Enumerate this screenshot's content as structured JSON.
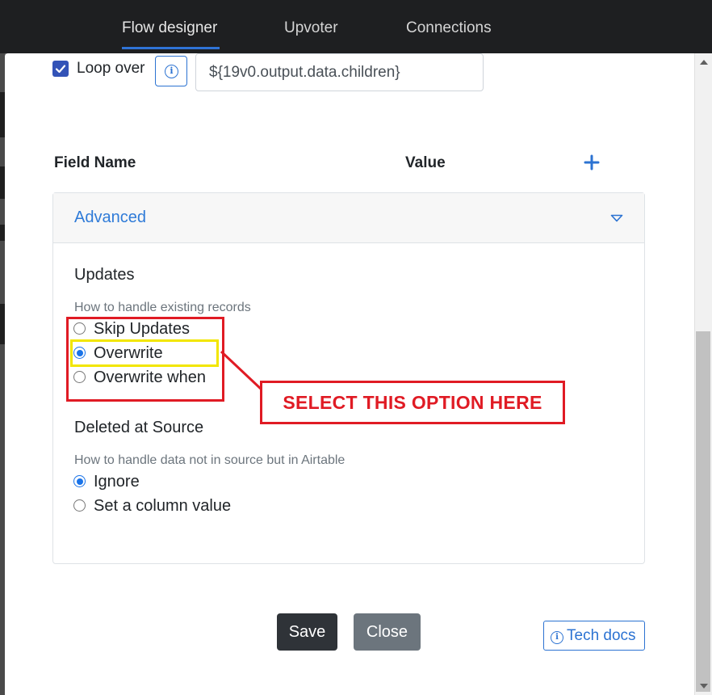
{
  "nav": {
    "tabs": [
      {
        "label": "Flow designer",
        "active": true
      },
      {
        "label": "Upvoter",
        "active": false
      },
      {
        "label": "Connections",
        "active": false
      }
    ]
  },
  "loop": {
    "checked": true,
    "label": "Loop over",
    "info_icon": "info-icon",
    "value": "${19v0.output.data.children}"
  },
  "fields": {
    "name_header": "Field Name",
    "value_header": "Value",
    "add_icon": "plus-icon"
  },
  "advanced": {
    "title": "Advanced",
    "chevron_icon": "chevron-down-icon",
    "updates": {
      "title": "Updates",
      "help": "How to handle existing records",
      "options": [
        {
          "label": "Skip Updates",
          "selected": false
        },
        {
          "label": "Overwrite",
          "selected": true
        },
        {
          "label": "Overwrite when",
          "selected": false
        }
      ]
    },
    "deleted": {
      "title": "Deleted at Source",
      "help": "How to handle data not in source but in Airtable",
      "options": [
        {
          "label": "Ignore",
          "selected": true
        },
        {
          "label": "Set a column value",
          "selected": false
        }
      ]
    }
  },
  "annotation": {
    "callout_text": "SELECT THIS OPTION HERE",
    "box_color": "#e01b24",
    "highlight_color": "#f2e600"
  },
  "footer": {
    "save_label": "Save",
    "close_label": "Close",
    "docs_label": "Tech docs"
  },
  "colors": {
    "accent": "#2c73d2",
    "nav_bg": "#1e1f21",
    "save_bg": "#2f3338",
    "close_bg": "#6c757d"
  }
}
